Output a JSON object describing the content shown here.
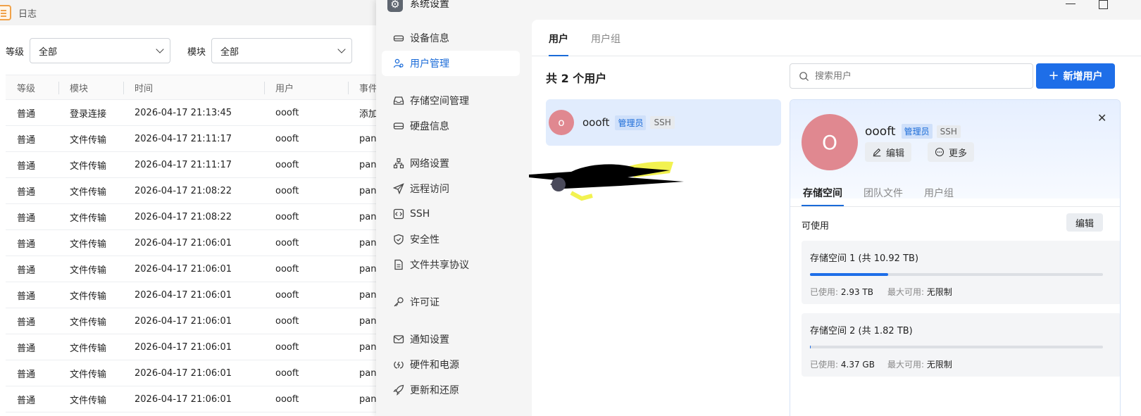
{
  "log_window": {
    "title": "日志",
    "filters": [
      {
        "label": "等级",
        "value": "全部"
      },
      {
        "label": "模块",
        "value": "全部"
      }
    ],
    "columns": [
      "等级",
      "模块",
      "时间",
      "用户",
      "事件"
    ],
    "rows": [
      [
        "普通",
        "登录连接",
        "2026-04-17 21:13:45",
        "oooft",
        "添加"
      ],
      [
        "普通",
        "文件传输",
        "2026-04-17 21:11:17",
        "oooft",
        "pan"
      ],
      [
        "普通",
        "文件传输",
        "2026-04-17 21:11:17",
        "oooft",
        "pan"
      ],
      [
        "普通",
        "文件传输",
        "2026-04-17 21:08:22",
        "oooft",
        "pan"
      ],
      [
        "普通",
        "文件传输",
        "2026-04-17 21:08:22",
        "oooft",
        "pan"
      ],
      [
        "普通",
        "文件传输",
        "2026-04-17 21:06:01",
        "oooft",
        "pan"
      ],
      [
        "普通",
        "文件传输",
        "2026-04-17 21:06:01",
        "oooft",
        "pan"
      ],
      [
        "普通",
        "文件传输",
        "2026-04-17 21:06:01",
        "oooft",
        "pan"
      ],
      [
        "普通",
        "文件传输",
        "2026-04-17 21:06:01",
        "oooft",
        "pan"
      ],
      [
        "普通",
        "文件传输",
        "2026-04-17 21:06:01",
        "oooft",
        "pan"
      ],
      [
        "普通",
        "文件传输",
        "2026-04-17 21:06:01",
        "oooft",
        "pan"
      ],
      [
        "普通",
        "文件传输",
        "2026-04-17 21:06:01",
        "oooft",
        "pan"
      ]
    ]
  },
  "settings_window": {
    "title": "系统设置",
    "nav": [
      {
        "label": "设备信息",
        "icon": "drive-icon"
      },
      {
        "label": "用户管理",
        "icon": "users-icon",
        "active": true
      },
      {
        "label": "存储空间管理",
        "icon": "storage-icon"
      },
      {
        "label": "硬盘信息",
        "icon": "disk-icon"
      },
      {
        "label": "网络设置",
        "icon": "network-icon"
      },
      {
        "label": "远程访问",
        "icon": "send-icon"
      },
      {
        "label": "SSH",
        "icon": "code-icon"
      },
      {
        "label": "安全性",
        "icon": "shield-icon"
      },
      {
        "label": "文件共享协议",
        "icon": "file-icon"
      },
      {
        "label": "许可证",
        "icon": "key-icon"
      },
      {
        "label": "通知设置",
        "icon": "mail-icon"
      },
      {
        "label": "硬件和电源",
        "icon": "power-icon"
      },
      {
        "label": "更新和还原",
        "icon": "rocket-icon"
      }
    ],
    "tabs": [
      "用户",
      "用户组"
    ],
    "user_count": "共 2 个用户",
    "search_placeholder": "搜索用户",
    "add_user_label": "新增用户",
    "user_list": [
      {
        "initial": "o",
        "name": "oooft",
        "badges": [
          "管理员",
          "SSH"
        ]
      }
    ],
    "detail": {
      "initial": "O",
      "name": "oooft",
      "badges": [
        "管理员",
        "SSH"
      ],
      "edit_label": "编辑",
      "more_label": "更多",
      "close_symbol": "✕",
      "sub_tabs": [
        "存储空间",
        "团队文件",
        "用户组"
      ],
      "available_label": "可使用",
      "available_edit_label": "编辑",
      "pools": [
        {
          "title": "存储空间 1 (共 10.92 TB)",
          "used_label": "已使用:",
          "used": "2.93 TB",
          "max_label": "最大可用:",
          "max": "无限制",
          "fraction": 0.268
        },
        {
          "title": "存储空间 2 (共 1.82 TB)",
          "used_label": "已使用:",
          "used": "4.37 GB",
          "max_label": "最大可用:",
          "max": "无限制",
          "fraction": 0.002
        }
      ]
    }
  },
  "colors": {
    "accent": "#1e6ee8",
    "avatar": "#e08890",
    "log_icon": "#f0a24a"
  }
}
